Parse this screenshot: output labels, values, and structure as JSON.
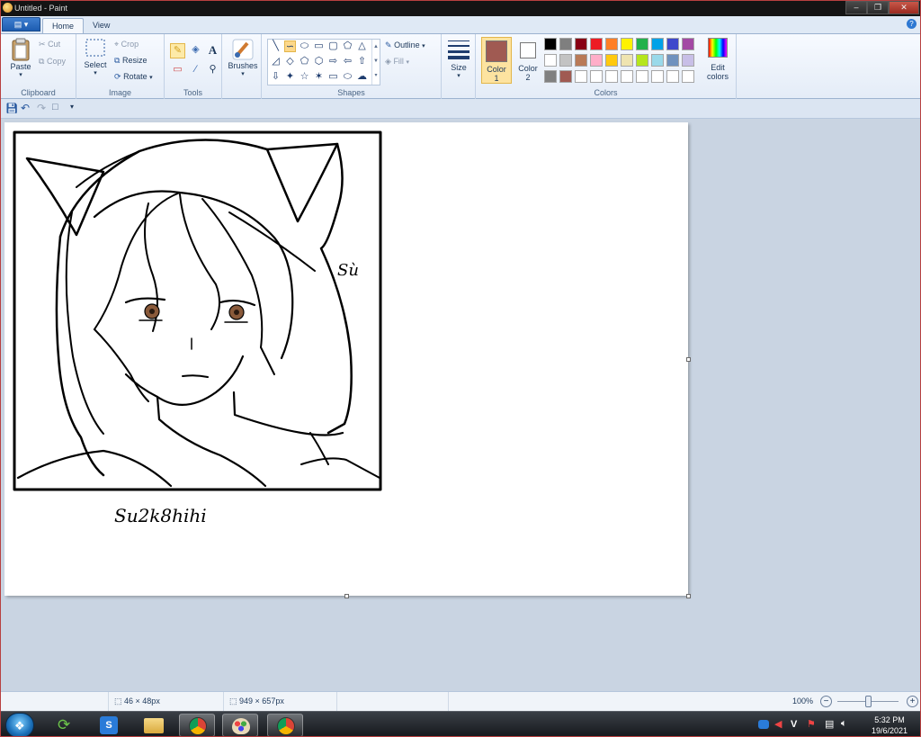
{
  "window": {
    "title": "Untitled - Paint"
  },
  "tabs": [
    {
      "label": "Home"
    },
    {
      "label": "View"
    }
  ],
  "clipboard": {
    "paste": "Paste",
    "cut": "Cut",
    "copy": "Copy",
    "group": "Clipboard"
  },
  "image": {
    "select": "Select",
    "crop": "Crop",
    "resize": "Resize",
    "rotate": "Rotate",
    "group": "Image"
  },
  "tools": {
    "group": "Tools"
  },
  "brushes": {
    "label": "Brushes"
  },
  "shapes": {
    "outline": "Outline",
    "fill": "Fill",
    "group": "Shapes"
  },
  "size": {
    "label": "Size"
  },
  "colors": {
    "color1_label": "Color",
    "color1_num": "1",
    "color2_label": "Color",
    "color2_num": "2",
    "edit_label": "Edit",
    "edit_label2": "colors",
    "group": "Colors",
    "color1_value": "#a05a52",
    "color2_value": "#ffffff",
    "palette_row1": [
      "#000000",
      "#7f7f7f",
      "#880015",
      "#ed1c24",
      "#ff7f27",
      "#fff200",
      "#22b14c",
      "#00a2e8",
      "#3f48cc",
      "#a349a4"
    ],
    "palette_row2": [
      "#ffffff",
      "#c3c3c3",
      "#b97a57",
      "#ffaec9",
      "#ffc90e",
      "#efe4b0",
      "#b5e61d",
      "#99d9ea",
      "#7092be",
      "#c8bfe7"
    ],
    "palette_row3": [
      "#808080",
      "#a05a52",
      "#ffffff",
      "#ffffff",
      "#ffffff",
      "#ffffff",
      "#ffffff",
      "#ffffff",
      "#ffffff",
      "#ffffff"
    ]
  },
  "canvas_art": {
    "side_text": "Sù",
    "signature": "Su2k8hihi"
  },
  "status": {
    "selection_size": "46 × 48px",
    "canvas_size": "949 × 657px",
    "zoom": "100%"
  },
  "taskbar": {
    "time": "5:32 PM",
    "date": "19/6/2021",
    "lang": "V"
  }
}
